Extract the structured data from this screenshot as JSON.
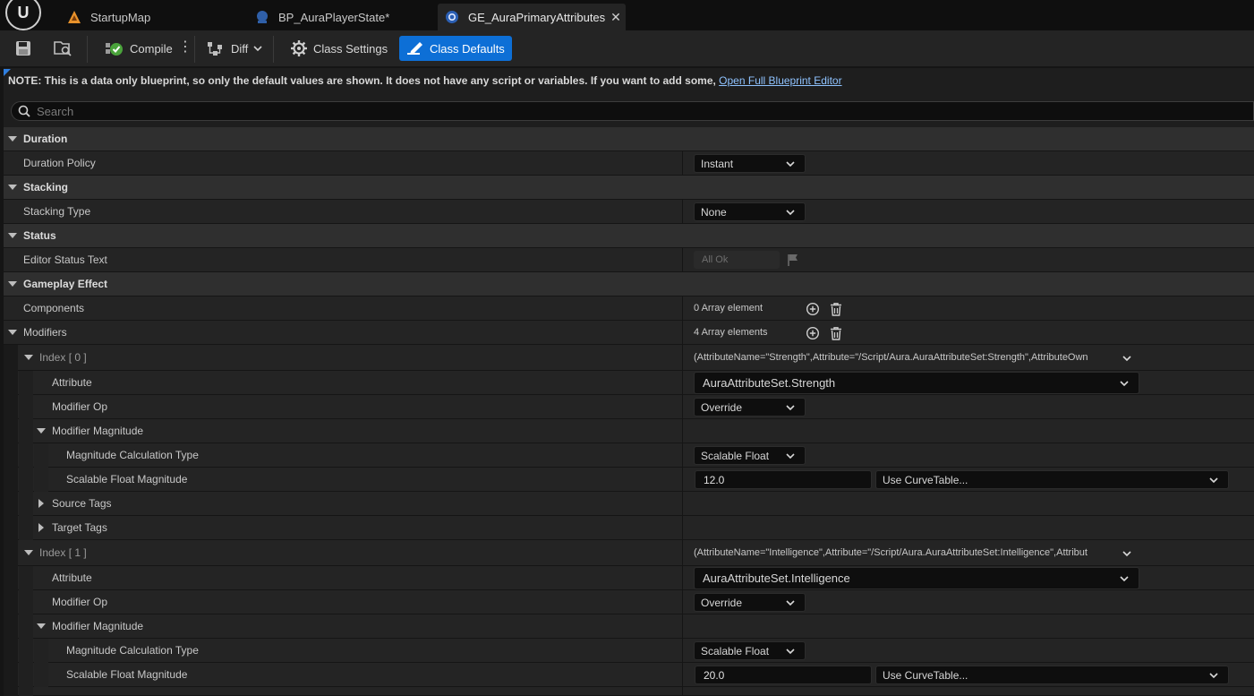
{
  "tabs": [
    {
      "label": "StartupMap",
      "icon": "level-map-icon"
    },
    {
      "label": "BP_AuraPlayerState*",
      "icon": "blueprint-icon"
    },
    {
      "label": "GE_AuraPrimaryAttributes",
      "icon": "gameplay-effect-icon",
      "active": true
    }
  ],
  "toolbar": {
    "compile_label": "Compile",
    "diff_label": "Diff",
    "class_settings_label": "Class Settings",
    "class_defaults_label": "Class Defaults"
  },
  "note": {
    "text": "NOTE: This is a data only blueprint, so only the default values are shown.  It does not have any script or variables.  If you want to add some,",
    "link": "Open Full Blueprint Editor"
  },
  "search": {
    "placeholder": "Search"
  },
  "details": {
    "duration_header": "Duration",
    "duration_policy_label": "Duration Policy",
    "duration_policy_value": "Instant",
    "stacking_header": "Stacking",
    "stacking_type_label": "Stacking Type",
    "stacking_type_value": "None",
    "status_header": "Status",
    "editor_status_label": "Editor Status Text",
    "editor_status_value": "All Ok",
    "gameplay_effect_header": "Gameplay Effect",
    "components_label": "Components",
    "components_value": "0 Array element",
    "modifiers_label": "Modifiers",
    "modifiers_value": "4 Array elements",
    "modifiers": [
      {
        "index_label": "Index [ 0 ]",
        "summary": "(AttributeName=\"Strength\",Attribute=\"/Script/Aura.AuraAttributeSet:Strength\",AttributeOwn",
        "attribute_label": "Attribute",
        "attribute_value": "AuraAttributeSet.Strength",
        "modifier_op_label": "Modifier Op",
        "modifier_op_value": "Override",
        "magnitude_label": "Modifier Magnitude",
        "calc_type_label": "Magnitude Calculation Type",
        "calc_type_value": "Scalable Float",
        "scalable_label": "Scalable Float Magnitude",
        "scalable_value": "12.0",
        "curve_value": "Use CurveTable...",
        "source_tags_label": "Source Tags",
        "target_tags_label": "Target Tags"
      },
      {
        "index_label": "Index [ 1 ]",
        "summary": "(AttributeName=\"Intelligence\",Attribute=\"/Script/Aura.AuraAttributeSet:Intelligence\",Attribut",
        "attribute_label": "Attribute",
        "attribute_value": "AuraAttributeSet.Intelligence",
        "modifier_op_label": "Modifier Op",
        "modifier_op_value": "Override",
        "magnitude_label": "Modifier Magnitude",
        "calc_type_label": "Magnitude Calculation Type",
        "calc_type_value": "Scalable Float",
        "scalable_label": "Scalable Float Magnitude",
        "scalable_value": "20.0",
        "curve_value": "Use CurveTable..."
      }
    ]
  },
  "colors": {
    "accent": "#0d6fd6",
    "link": "#8fc3ff",
    "panel": "#242424",
    "category": "#2f2f2f"
  }
}
